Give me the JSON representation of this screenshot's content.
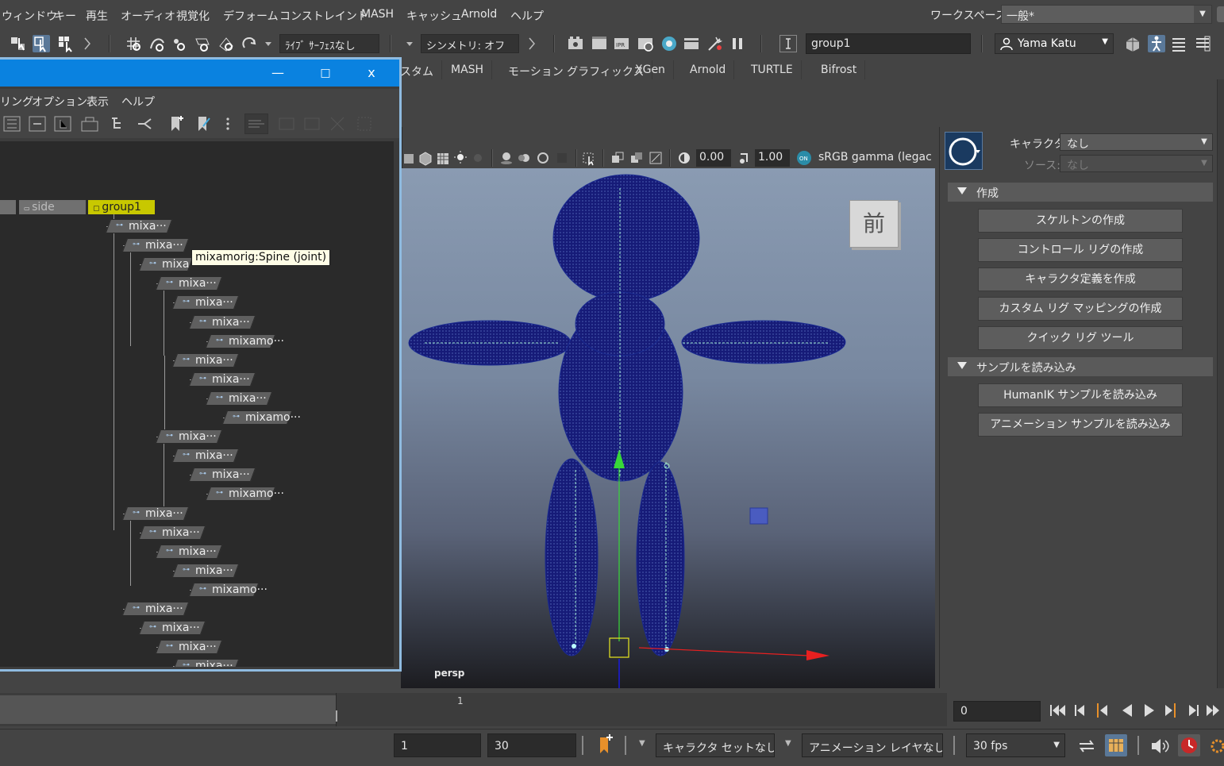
{
  "menubar": {
    "items": [
      "ウィンドウ",
      "キー",
      "再生",
      "オーディオ",
      "視覚化",
      "デフォーム",
      "コンストレイント",
      "MASH",
      "キャッシュ",
      "Arnold",
      "ヘルプ"
    ],
    "workspace_label": "ワークスペース:",
    "workspace_value": "一般*"
  },
  "toolbar": {
    "live_surface": "ﾗｲﾌﾞ ｻｰﾌｪｽなし",
    "symmetry": "シンメトリ: オフ",
    "object_field": "group1",
    "user": "Yama Katu"
  },
  "shelf": {
    "tabs": [
      "スタム",
      "MASH",
      "モーション グラフィックス",
      "XGen",
      "Arnold",
      "TURTLE",
      "Bifrost"
    ]
  },
  "viewport": {
    "exposure": "0.00",
    "gamma": "1.00",
    "color_space": "sRGB gamma (legac",
    "camera_label": "persp",
    "viewcube_label": "前"
  },
  "outliner": {
    "minimize": "—",
    "maximize": "□",
    "close": "x",
    "menu": [
      "リング",
      "オプション",
      "表示",
      "ヘルプ"
    ],
    "top_nodes": {
      "side": "side",
      "group": "group1"
    },
    "tooltip": "mixamorig:Spine (joint)",
    "nodes": [
      {
        "label": "mixa···"
      },
      {
        "label": "mixa···"
      },
      {
        "label": "mixa"
      },
      {
        "label": "mixa···"
      },
      {
        "label": "mixa···"
      },
      {
        "label": "mixa···"
      },
      {
        "label": "mixamo···"
      },
      {
        "label": "mixa···"
      },
      {
        "label": "mixa···"
      },
      {
        "label": "mixa···"
      },
      {
        "label": "mixamo···"
      },
      {
        "label": "mixa···"
      },
      {
        "label": "mixa···"
      },
      {
        "label": "mixa···"
      },
      {
        "label": "mixamo···"
      },
      {
        "label": "mixa···"
      },
      {
        "label": "mixa···"
      },
      {
        "label": "mixa···"
      },
      {
        "label": "mixa···"
      },
      {
        "label": "mixamo···"
      },
      {
        "label": "mixa···"
      },
      {
        "label": "mixa···"
      },
      {
        "label": "mixa···"
      },
      {
        "label": "mixa···"
      }
    ]
  },
  "hik": {
    "character_label": "キャラクタ:",
    "character_value": "なし",
    "source_label": "ソース:",
    "source_value": "なし",
    "section_create": "作成",
    "buttons_create": [
      "スケルトンの作成",
      "コントロール リグの作成",
      "キャラクタ定義を作成",
      "カスタム リグ マッピングの作成",
      "クイック リグ ツール"
    ],
    "section_samples": "サンプルを読み込み",
    "buttons_samples": [
      "HumanIK サンプルを読み込み",
      "アニメーション サンプルを読み込み"
    ]
  },
  "timeline": {
    "frame_marker": "1",
    "current_time": "0"
  },
  "range": {
    "start": "1",
    "end": "30",
    "character_set": "キャラクタ セットなし",
    "anim_layer": "アニメーション レイヤなし",
    "fps": "30 fps"
  },
  "colors": {
    "accent": "#0a82e0",
    "selected_node": "#c8c800",
    "mesh": "#1a1f7a"
  }
}
